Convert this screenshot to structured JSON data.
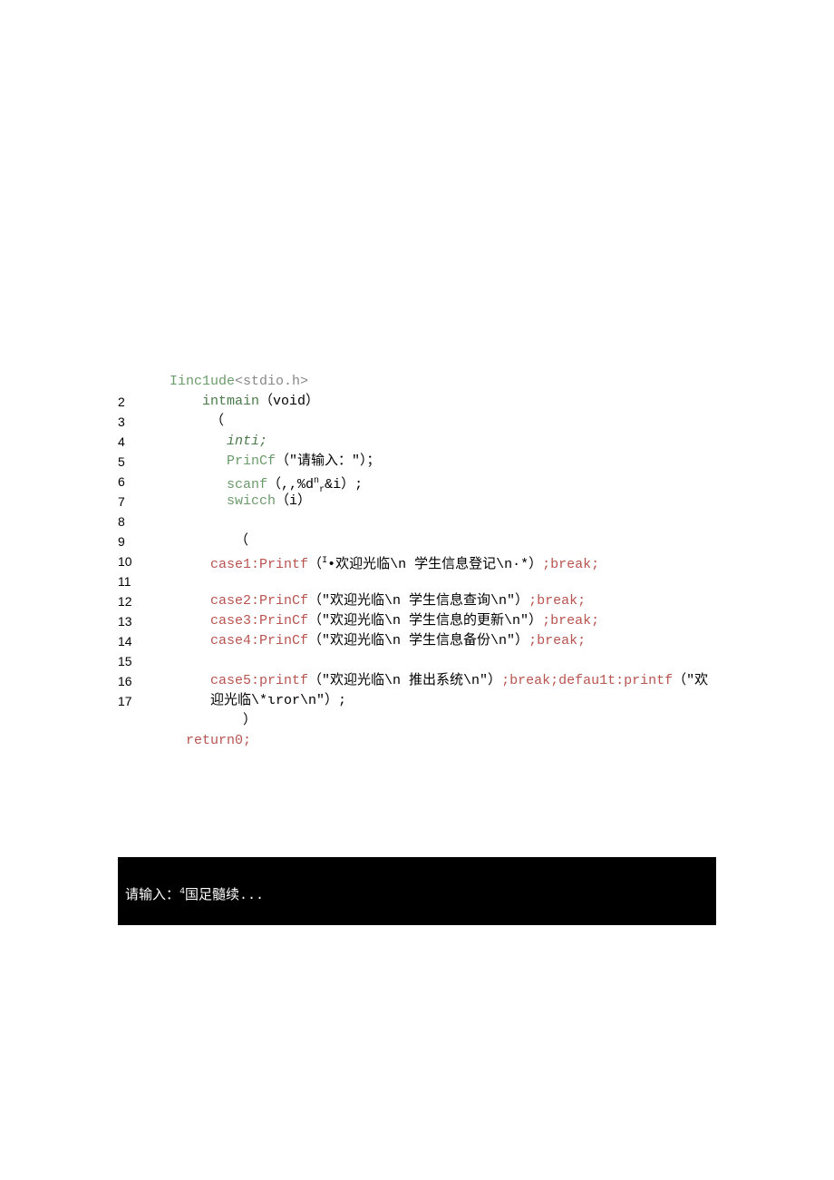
{
  "code": {
    "line1": {
      "num": "",
      "include": "Iinc1ude",
      "header": "<stdio.h>"
    },
    "line2": {
      "num": "2",
      "intmain": "intmain",
      "void": "（void）"
    },
    "line3": {
      "num": "3",
      "paren": "（"
    },
    "line4": {
      "num": "4",
      "inti": "inti;"
    },
    "line5": {
      "num": "5",
      "printf": "PrinCf",
      "text": "（\"请输入：\"）；"
    },
    "line6": {
      "num": "6",
      "scanf": "scanf",
      "text": "（,,%d",
      "sup": "n",
      "sub": "r",
      "text2": "&i）;"
    },
    "line7": {
      "num": "7",
      "switch": "swicch",
      "text": "（i）"
    },
    "line8": {
      "num": "8"
    },
    "line9": {
      "num": "9",
      "paren": "（"
    },
    "line10": {
      "num": "10",
      "case": "case1:Printf",
      "text": "（",
      "sup": "I",
      "text2": "•欢迎光临\\n 学生信息登记\\n·*）",
      "break": ";break;"
    },
    "line11": {
      "num": "11"
    },
    "line12": {
      "num": "12",
      "case": "case2:PrinCf",
      "text": "（\"欢迎光临\\n 学生信息查询\\n\"）",
      "break": ";break;"
    },
    "line13": {
      "num": "13",
      "case": "case3:PrinCf",
      "text": "（\"欢迎光临\\n 学生信息的更新\\n\"）",
      "break": ";break;"
    },
    "line14": {
      "num": "14",
      "case": "case4:PrinCf",
      "text": "（\"欢迎光临\\n 学生信息备份\\n\"）",
      "break": ";break;"
    },
    "line15": {
      "num": "15"
    },
    "line16": {
      "num": "16",
      "case": "case5:printf",
      "text": "（\"欢迎光临\\n 推出系统\\n\"）",
      "break": ";break;",
      "default": "defau1t:printf",
      "text2": "（\"欢"
    },
    "line17": {
      "num": "17",
      "text": "迎光临\\*ιror\\n\"）;"
    },
    "line18": {
      "paren": "）"
    },
    "line19": {
      "return": "return0;"
    }
  },
  "terminal": {
    "text": "请输入：",
    "sup": "4",
    "text2": "国足髓续..."
  }
}
